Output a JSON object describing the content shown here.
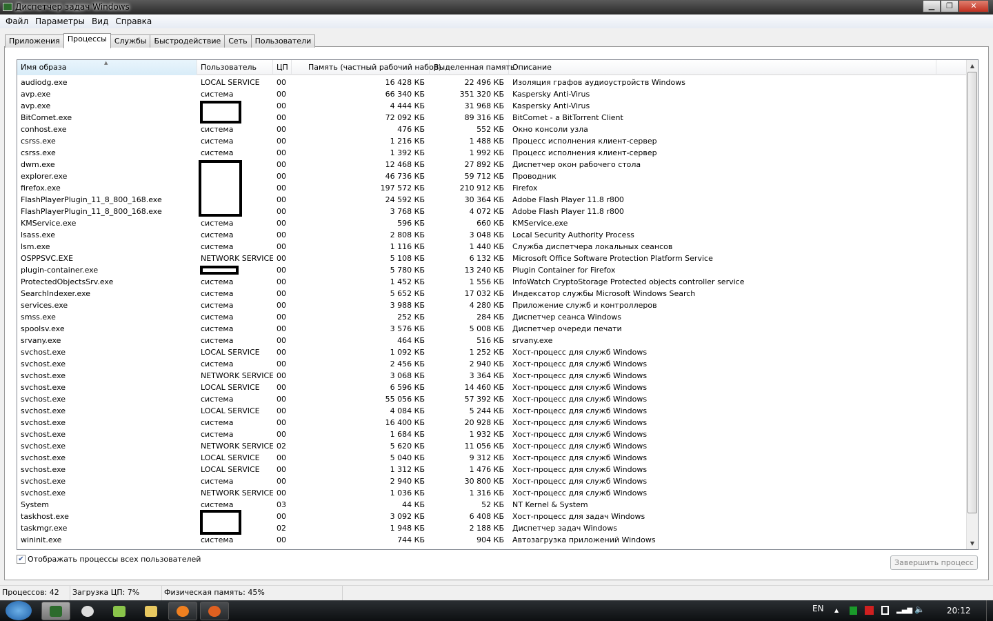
{
  "window": {
    "title": "Диспетчер задач Windows",
    "minimize": "▁",
    "maximize": "❐",
    "close": "✕"
  },
  "menu": [
    "Файл",
    "Параметры",
    "Вид",
    "Справка"
  ],
  "tabs": [
    {
      "label": "Приложения"
    },
    {
      "label": "Процессы",
      "active": true
    },
    {
      "label": "Службы"
    },
    {
      "label": "Быстродействие"
    },
    {
      "label": "Сеть"
    },
    {
      "label": "Пользователи"
    }
  ],
  "columns": [
    "Имя образа",
    "Пользователь",
    "ЦП",
    "Память (частный рабочий набор)",
    "Выделенная память",
    "Описание"
  ],
  "sort_column": "Имя образа",
  "processes": [
    [
      "audiodg.exe",
      "LOCAL SERVICE",
      "00",
      "16 428 КБ",
      "22 496 КБ",
      "Изоляция графов аудиоустройств Windows"
    ],
    [
      "avp.exe",
      "система",
      "00",
      "66 340 КБ",
      "351 320 КБ",
      "Kaspersky Anti-Virus"
    ],
    [
      "avp.exe",
      "",
      "00",
      "4 444 КБ",
      "31 968 КБ",
      "Kaspersky Anti-Virus"
    ],
    [
      "BitComet.exe",
      "",
      "00",
      "72 092 КБ",
      "89 316 КБ",
      "BitComet - a BitTorrent Client"
    ],
    [
      "conhost.exe",
      "система",
      "00",
      "476 КБ",
      "552 КБ",
      "Окно консоли узла"
    ],
    [
      "csrss.exe",
      "система",
      "00",
      "1 216 КБ",
      "1 488 КБ",
      "Процесс исполнения клиент-сервер"
    ],
    [
      "csrss.exe",
      "система",
      "00",
      "1 392 КБ",
      "1 992 КБ",
      "Процесс исполнения клиент-сервер"
    ],
    [
      "dwm.exe",
      "",
      "00",
      "12 468 КБ",
      "27 892 КБ",
      "Диспетчер окон рабочего стола"
    ],
    [
      "explorer.exe",
      "",
      "00",
      "46 736 КБ",
      "59 712 КБ",
      "Проводник"
    ],
    [
      "firefox.exe",
      "",
      "00",
      "197 572 КБ",
      "210 912 КБ",
      "Firefox"
    ],
    [
      "FlashPlayerPlugin_11_8_800_168.exe",
      "",
      "00",
      "24 592 КБ",
      "30 364 КБ",
      "Adobe Flash Player 11.8 r800"
    ],
    [
      "FlashPlayerPlugin_11_8_800_168.exe",
      "",
      "00",
      "3 768 КБ",
      "4 072 КБ",
      "Adobe Flash Player 11.8 r800"
    ],
    [
      "KMService.exe",
      "система",
      "00",
      "596 КБ",
      "660 КБ",
      "KMService.exe"
    ],
    [
      "lsass.exe",
      "система",
      "00",
      "2 808 КБ",
      "3 048 КБ",
      "Local Security Authority Process"
    ],
    [
      "lsm.exe",
      "система",
      "00",
      "1 116 КБ",
      "1 440 КБ",
      "Служба диспетчера локальных сеансов"
    ],
    [
      "OSPPSVC.EXE",
      "NETWORK SERVICE",
      "00",
      "5 108 КБ",
      "6 132 КБ",
      "Microsoft Office Software Protection Platform Service"
    ],
    [
      "plugin-container.exe",
      "",
      "00",
      "5 780 КБ",
      "13 240 КБ",
      "Plugin Container for Firefox"
    ],
    [
      "ProtectedObjectsSrv.exe",
      "система",
      "00",
      "1 452 КБ",
      "1 556 КБ",
      "InfoWatch CryptoStorage Protected objects controller service"
    ],
    [
      "SearchIndexer.exe",
      "система",
      "00",
      "5 652 КБ",
      "17 032 КБ",
      "Индексатор службы Microsoft Windows Search"
    ],
    [
      "services.exe",
      "система",
      "00",
      "3 988 КБ",
      "4 280 КБ",
      "Приложение служб и контроллеров"
    ],
    [
      "smss.exe",
      "система",
      "00",
      "252 КБ",
      "284 КБ",
      "Диспетчер сеанса  Windows"
    ],
    [
      "spoolsv.exe",
      "система",
      "00",
      "3 576 КБ",
      "5 008 КБ",
      "Диспетчер очереди печати"
    ],
    [
      "srvany.exe",
      "система",
      "00",
      "464 КБ",
      "516 КБ",
      "srvany.exe"
    ],
    [
      "svchost.exe",
      "LOCAL SERVICE",
      "00",
      "1 092 КБ",
      "1 252 КБ",
      "Хост-процесс для служб Windows"
    ],
    [
      "svchost.exe",
      "система",
      "00",
      "2 456 КБ",
      "2 940 КБ",
      "Хост-процесс для служб Windows"
    ],
    [
      "svchost.exe",
      "NETWORK SERVICE",
      "00",
      "3 068 КБ",
      "3 364 КБ",
      "Хост-процесс для служб Windows"
    ],
    [
      "svchost.exe",
      "LOCAL SERVICE",
      "00",
      "6 596 КБ",
      "14 460 КБ",
      "Хост-процесс для служб Windows"
    ],
    [
      "svchost.exe",
      "система",
      "00",
      "55 056 КБ",
      "57 392 КБ",
      "Хост-процесс для служб Windows"
    ],
    [
      "svchost.exe",
      "LOCAL SERVICE",
      "00",
      "4 084 КБ",
      "5 244 КБ",
      "Хост-процесс для служб Windows"
    ],
    [
      "svchost.exe",
      "система",
      "00",
      "16 400 КБ",
      "20 928 КБ",
      "Хост-процесс для служб Windows"
    ],
    [
      "svchost.exe",
      "система",
      "00",
      "1 684 КБ",
      "1 932 КБ",
      "Хост-процесс для служб Windows"
    ],
    [
      "svchost.exe",
      "NETWORK SERVICE",
      "02",
      "5 620 КБ",
      "11 056 КБ",
      "Хост-процесс для служб Windows"
    ],
    [
      "svchost.exe",
      "LOCAL SERVICE",
      "00",
      "5 040 КБ",
      "9 312 КБ",
      "Хост-процесс для служб Windows"
    ],
    [
      "svchost.exe",
      "LOCAL SERVICE",
      "00",
      "1 312 КБ",
      "1 476 КБ",
      "Хост-процесс для служб Windows"
    ],
    [
      "svchost.exe",
      "система",
      "00",
      "2 940 КБ",
      "30 800 КБ",
      "Хост-процесс для служб Windows"
    ],
    [
      "svchost.exe",
      "NETWORK SERVICE",
      "00",
      "1 036 КБ",
      "1 316 КБ",
      "Хост-процесс для служб Windows"
    ],
    [
      "System",
      "система",
      "03",
      "44 КБ",
      "52 КБ",
      "NT Kernel & System"
    ],
    [
      "taskhost.exe",
      "",
      "00",
      "3 092 КБ",
      "6 408 КБ",
      "Хост-процесс для задач Windows"
    ],
    [
      "taskmgr.exe",
      "",
      "02",
      "1 948 КБ",
      "2 188 КБ",
      "Диспетчер задач Windows"
    ],
    [
      "wininit.exe",
      "система",
      "00",
      "744 КБ",
      "904 КБ",
      "Автозагрузка приложений Windows"
    ]
  ],
  "show_all_users": {
    "label": "Отображать процессы всех пользователей",
    "checked": true
  },
  "end_process_button": "Завершить процесс",
  "status": {
    "processes": "Процессов: 42",
    "cpu": "Загрузка ЦП: 7%",
    "memory": "Физическая память: 45%"
  },
  "tray": {
    "lang": "EN",
    "show_hidden": "▲",
    "clock": "20:12"
  },
  "taskbar_apps": [
    "task-manager",
    "clock-app",
    "network-app",
    "file-explorer",
    "bitcomet",
    "firefox"
  ]
}
